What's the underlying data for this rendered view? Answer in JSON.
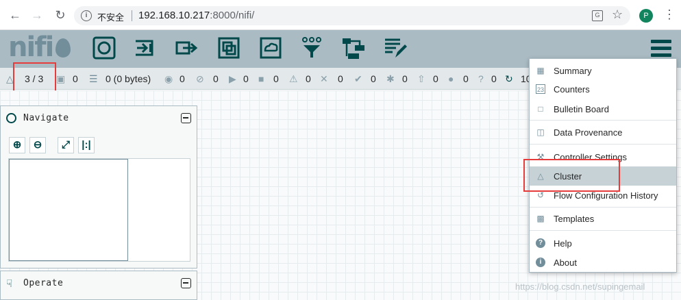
{
  "browser": {
    "security_label": "不安全",
    "url_host": "192.168.10.217",
    "url_rest": ":8000/nifi/",
    "avatar_letter": "P",
    "icons": [
      "back-arrow-icon",
      "forward-arrow-icon",
      "reload-icon",
      "info-icon",
      "translate-icon",
      "star-icon",
      "kebab-menu-icon"
    ]
  },
  "header": {
    "logo_text": "nifi",
    "toolbar_icons": [
      "processor-icon",
      "input-port-icon",
      "output-port-icon",
      "process-group-icon",
      "remote-process-group-icon",
      "funnel-icon",
      "template-icon",
      "label-icon"
    ],
    "menu_icon": "hamburger-icon"
  },
  "status": {
    "cluster": "3 / 3",
    "threads": "0",
    "queued": "0 (0 bytes)",
    "transmitting": "0",
    "not_transmitting": "0",
    "running": "0",
    "stopped": "0",
    "invalid": "0",
    "disabled": "0",
    "up_to_date": "0",
    "locally_modified": "0",
    "stale": "0",
    "modified_stale": "0",
    "sync_failure": "0",
    "refresh": "10"
  },
  "navigate": {
    "title": "Navigate"
  },
  "operate": {
    "title": "Operate"
  },
  "menu": {
    "items": [
      {
        "label": "Summary",
        "icon": "table-icon"
      },
      {
        "label": "Counters",
        "icon": "counter-icon"
      },
      {
        "label": "Bulletin Board",
        "icon": "sticky-note-icon"
      },
      {
        "label": "Data Provenance",
        "icon": "provenance-icon"
      },
      {
        "label": "Controller Settings",
        "icon": "wrench-icon"
      },
      {
        "label": "Cluster",
        "icon": "cluster-icon"
      },
      {
        "label": "Flow Configuration History",
        "icon": "history-icon"
      },
      {
        "label": "Templates",
        "icon": "templates-icon"
      },
      {
        "label": "Help",
        "icon": "help-icon"
      },
      {
        "label": "About",
        "icon": "info-icon"
      }
    ]
  },
  "watermark": "https://blog.csdn.net/supingemail",
  "colors": {
    "header_bg": "#aabbc3",
    "accent": "#004849",
    "highlight": "#e53b3b",
    "menu_active": "#c7d2d7"
  }
}
